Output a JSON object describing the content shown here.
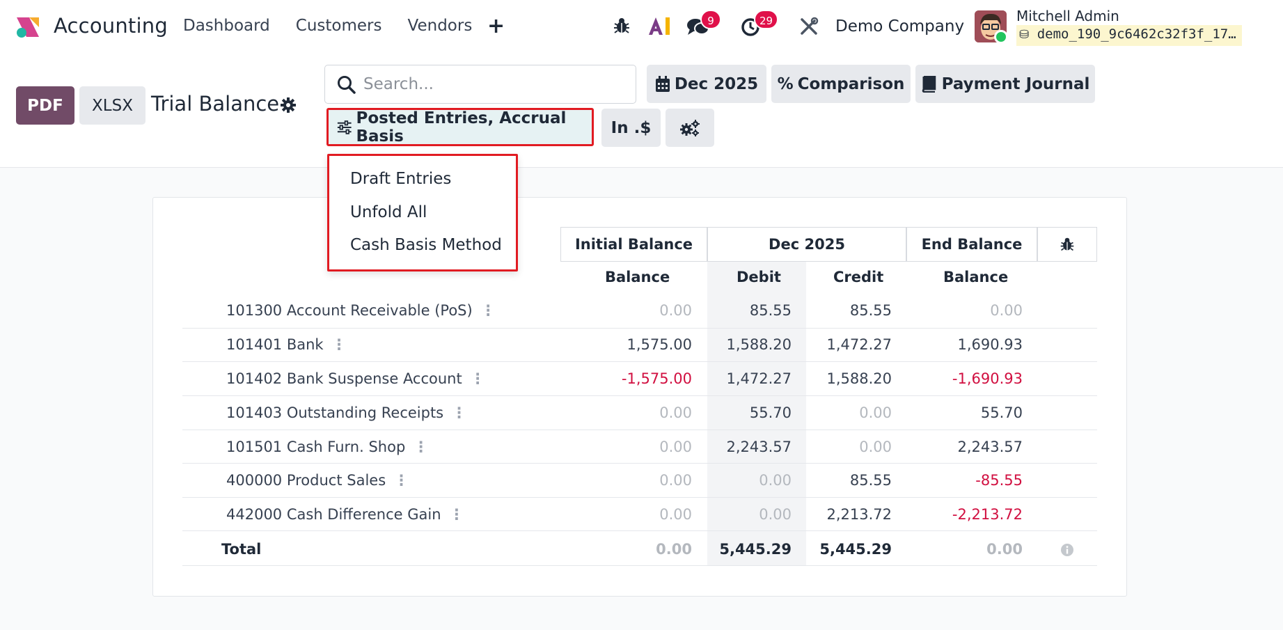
{
  "navbar": {
    "app_name": "Accounting",
    "menu": [
      "Dashboard",
      "Customers",
      "Vendors"
    ],
    "plus_symbol": "+",
    "messages_count": "9",
    "activities_count": "29",
    "company": "Demo Company",
    "user_name": "Mitchell Admin",
    "db_name": "demo_190_9c6462c32f3f_17…"
  },
  "control_panel": {
    "pdf_label": "PDF",
    "xlsx_label": "XLSX",
    "page_title": "Trial Balance",
    "search_placeholder": "Search...",
    "date_filter": "Dec 2025",
    "comparison": "Comparison",
    "journal": "Payment Journal",
    "entries_filter": "Posted Entries, Accrual Basis",
    "currency": "In .$"
  },
  "dropdown": {
    "items": [
      "Draft Entries",
      "Unfold All",
      "Cash Basis Method"
    ]
  },
  "report": {
    "group_headers": {
      "initial": "Initial Balance",
      "period": "Dec 2025",
      "end": "End Balance"
    },
    "sub_headers": {
      "initial_balance": "Balance",
      "debit": "Debit",
      "credit": "Credit",
      "end_balance": "Balance"
    },
    "kebab": "⋮",
    "rows": [
      {
        "account": "101300 Account Receivable (PoS)",
        "initial": "0.00",
        "debit": "85.55",
        "credit": "85.55",
        "end": "0.00"
      },
      {
        "account": "101401 Bank",
        "initial": "1,575.00",
        "debit": "1,588.20",
        "credit": "1,472.27",
        "end": "1,690.93"
      },
      {
        "account": "101402 Bank Suspense Account",
        "initial": "-1,575.00",
        "debit": "1,472.27",
        "credit": "1,588.20",
        "end": "-1,690.93"
      },
      {
        "account": "101403 Outstanding Receipts",
        "initial": "0.00",
        "debit": "55.70",
        "credit": "0.00",
        "end": "55.70"
      },
      {
        "account": "101501 Cash Furn. Shop",
        "initial": "0.00",
        "debit": "2,243.57",
        "credit": "0.00",
        "end": "2,243.57"
      },
      {
        "account": "400000 Product Sales",
        "initial": "0.00",
        "debit": "0.00",
        "credit": "85.55",
        "end": "-85.55"
      },
      {
        "account": "442000 Cash Difference Gain",
        "initial": "0.00",
        "debit": "0.00",
        "credit": "2,213.72",
        "end": "-2,213.72"
      }
    ],
    "total": {
      "label": "Total",
      "initial": "0.00",
      "debit": "5,445.29",
      "credit": "5,445.29",
      "end": "0.00"
    }
  },
  "colors": {
    "brand": "#714b67",
    "negative": "#d10f40",
    "highlight_border": "#e11b22",
    "badge": "#e0114a"
  }
}
